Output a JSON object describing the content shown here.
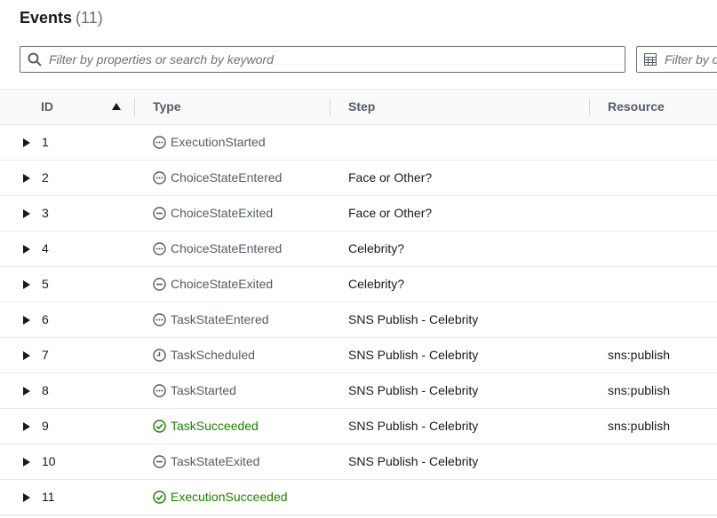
{
  "header": {
    "title": "Events",
    "count": "(11)"
  },
  "search": {
    "placeholder": "Filter by properties or search by keyword",
    "value": ""
  },
  "filter": {
    "label": "Filter by d"
  },
  "table": {
    "columns": {
      "id": "ID",
      "type": "Type",
      "step": "Step",
      "resource": "Resource"
    },
    "sort": {
      "column": "ID",
      "direction": "ascending"
    },
    "rows": [
      {
        "id": "1",
        "type": "ExecutionStarted",
        "status_icon": "dots-circle-icon",
        "status": "neutral",
        "step": "",
        "resource": ""
      },
      {
        "id": "2",
        "type": "ChoiceStateEntered",
        "status_icon": "dots-circle-icon",
        "status": "neutral",
        "step": "Face or Other?",
        "resource": ""
      },
      {
        "id": "3",
        "type": "ChoiceStateExited",
        "status_icon": "minus-circle-icon",
        "status": "neutral",
        "step": "Face or Other?",
        "resource": ""
      },
      {
        "id": "4",
        "type": "ChoiceStateEntered",
        "status_icon": "dots-circle-icon",
        "status": "neutral",
        "step": "Celebrity?",
        "resource": ""
      },
      {
        "id": "5",
        "type": "ChoiceStateExited",
        "status_icon": "minus-circle-icon",
        "status": "neutral",
        "step": "Celebrity?",
        "resource": ""
      },
      {
        "id": "6",
        "type": "TaskStateEntered",
        "status_icon": "dots-circle-icon",
        "status": "neutral",
        "step": "SNS Publish - Celebrity",
        "resource": ""
      },
      {
        "id": "7",
        "type": "TaskScheduled",
        "status_icon": "clock-icon",
        "status": "neutral",
        "step": "SNS Publish - Celebrity",
        "resource": "sns:publish"
      },
      {
        "id": "8",
        "type": "TaskStarted",
        "status_icon": "dots-circle-icon",
        "status": "neutral",
        "step": "SNS Publish - Celebrity",
        "resource": "sns:publish"
      },
      {
        "id": "9",
        "type": "TaskSucceeded",
        "status_icon": "check-circle-icon",
        "status": "success",
        "step": "SNS Publish - Celebrity",
        "resource": "sns:publish"
      },
      {
        "id": "10",
        "type": "TaskStateExited",
        "status_icon": "minus-circle-icon",
        "status": "neutral",
        "step": "SNS Publish - Celebrity",
        "resource": ""
      },
      {
        "id": "11",
        "type": "ExecutionSucceeded",
        "status_icon": "check-circle-icon",
        "status": "success",
        "step": "",
        "resource": ""
      }
    ]
  },
  "colors": {
    "neutral_text": "#545b64",
    "success": "#1d8102",
    "border": "#eaeded",
    "header_bg": "#fafafa"
  }
}
